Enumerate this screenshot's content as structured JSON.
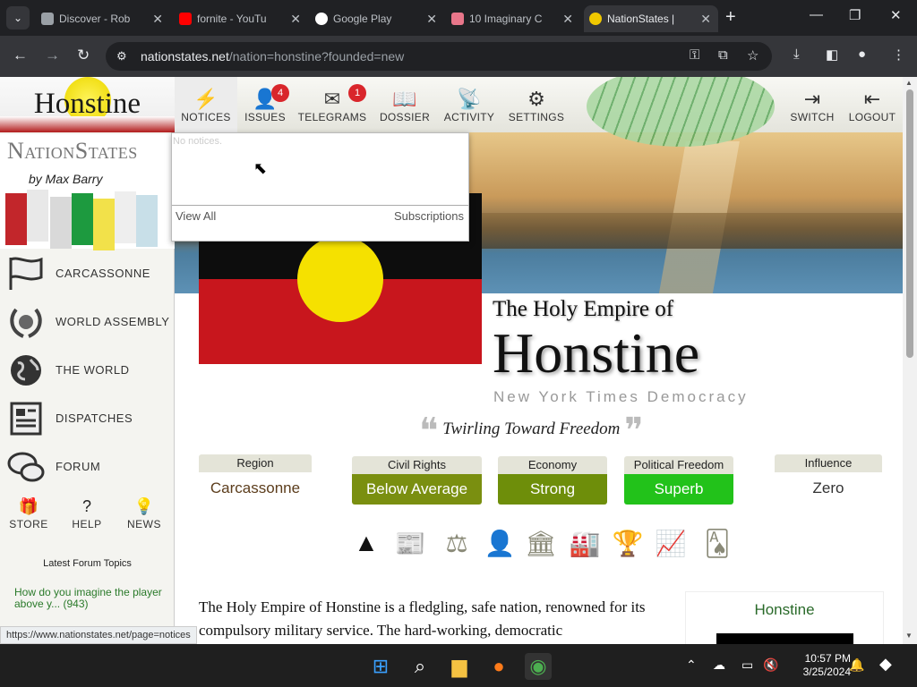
{
  "browser": {
    "tabs": [
      {
        "title": "Discover - Rob",
        "favicon_color": "#9aa0a6"
      },
      {
        "title": "fornite - YouTu",
        "favicon_color": "#ff0000"
      },
      {
        "title": "Google Play",
        "favicon_color": "#ffffff"
      },
      {
        "title": "10 Imaginary C",
        "favicon_color": "#e8768a"
      },
      {
        "title": "NationStates |",
        "favicon_color": "#f0c800"
      }
    ],
    "url_host": "nationstates.net",
    "url_path": "/nation=honstine?founded=new"
  },
  "sidebar": {
    "logo_text": "Honstine",
    "brand": "NationStates",
    "byline": "by Max Barry",
    "items": [
      {
        "label": "CARCASSONNE",
        "icon": "flag-icon"
      },
      {
        "label": "WORLD ASSEMBLY",
        "icon": "laurel-icon"
      },
      {
        "label": "THE WORLD",
        "icon": "globe-icon"
      },
      {
        "label": "DISPATCHES",
        "icon": "newspaper-icon"
      },
      {
        "label": "FORUM",
        "icon": "chat-bubbles-icon"
      }
    ],
    "mini": [
      {
        "label": "STORE",
        "icon": "gift-icon"
      },
      {
        "label": "HELP",
        "icon": "question-icon"
      },
      {
        "label": "NEWS",
        "icon": "lightbulb-icon"
      }
    ],
    "forum_heading": "Latest Forum Topics",
    "forum_topic": "How do you imagine the player above y... (943)"
  },
  "topnav": {
    "notices": "NOTICES",
    "issues": "ISSUES",
    "issues_badge": "4",
    "telegrams": "TELEGRAMS",
    "telegrams_badge": "1",
    "dossier": "DOSSIER",
    "activity": "ACTIVITY",
    "settings": "SETTINGS",
    "switch": "SWITCH",
    "logout": "LOGOUT"
  },
  "notices_dropdown": {
    "empty_text": "No notices.",
    "view_all": "View All",
    "subscriptions": "Subscriptions"
  },
  "nation": {
    "pretitle": "The Holy Empire of",
    "name": "Honstine",
    "category": "New York Times Democracy",
    "motto": "Twirling Toward Freedom",
    "summary": "The Holy Empire of Honstine is a fledgling, safe nation, renowned for its compulsory military service. The hard-working, democratic"
  },
  "stats": {
    "region_label": "Region",
    "region_value": "Carcassonne",
    "civil_rights_label": "Civil Rights",
    "civil_rights_value": "Below Average",
    "economy_label": "Economy",
    "economy_value": "Strong",
    "political_freedom_label": "Political Freedom",
    "political_freedom_value": "Superb",
    "influence_label": "Influence",
    "influence_value": "Zero"
  },
  "colors": {
    "civil_rights": "#7a8f10",
    "economy": "#6e8e0a",
    "political_freedom": "#22c21a",
    "badge": "#d9262b"
  },
  "side_card": {
    "name": "Honstine"
  },
  "status_url": "https://www.nationstates.net/page=notices",
  "taskbar": {
    "time": "10:57 PM",
    "date": "3/25/2024"
  }
}
